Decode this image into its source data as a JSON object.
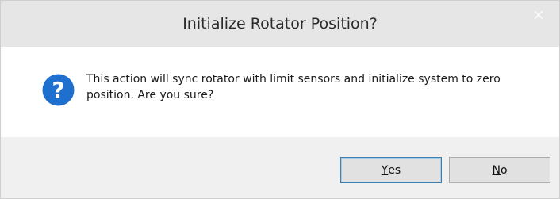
{
  "dialog": {
    "title": "Initialize Rotator Position?",
    "close_icon": "close-icon",
    "icon": "question-icon",
    "message": "This action will sync rotator with limit sensors and initialize system to zero position. Are you sure?",
    "buttons": {
      "yes": {
        "mnemonic": "Y",
        "rest": "es",
        "label": "Yes"
      },
      "no": {
        "mnemonic": "N",
        "rest": "o",
        "label": "No"
      }
    }
  },
  "colors": {
    "titlebar": "#e6e6e6",
    "footer": "#f0f0f0",
    "icon_blue": "#1f6fcf",
    "default_button_border": "#3c7fb1"
  }
}
